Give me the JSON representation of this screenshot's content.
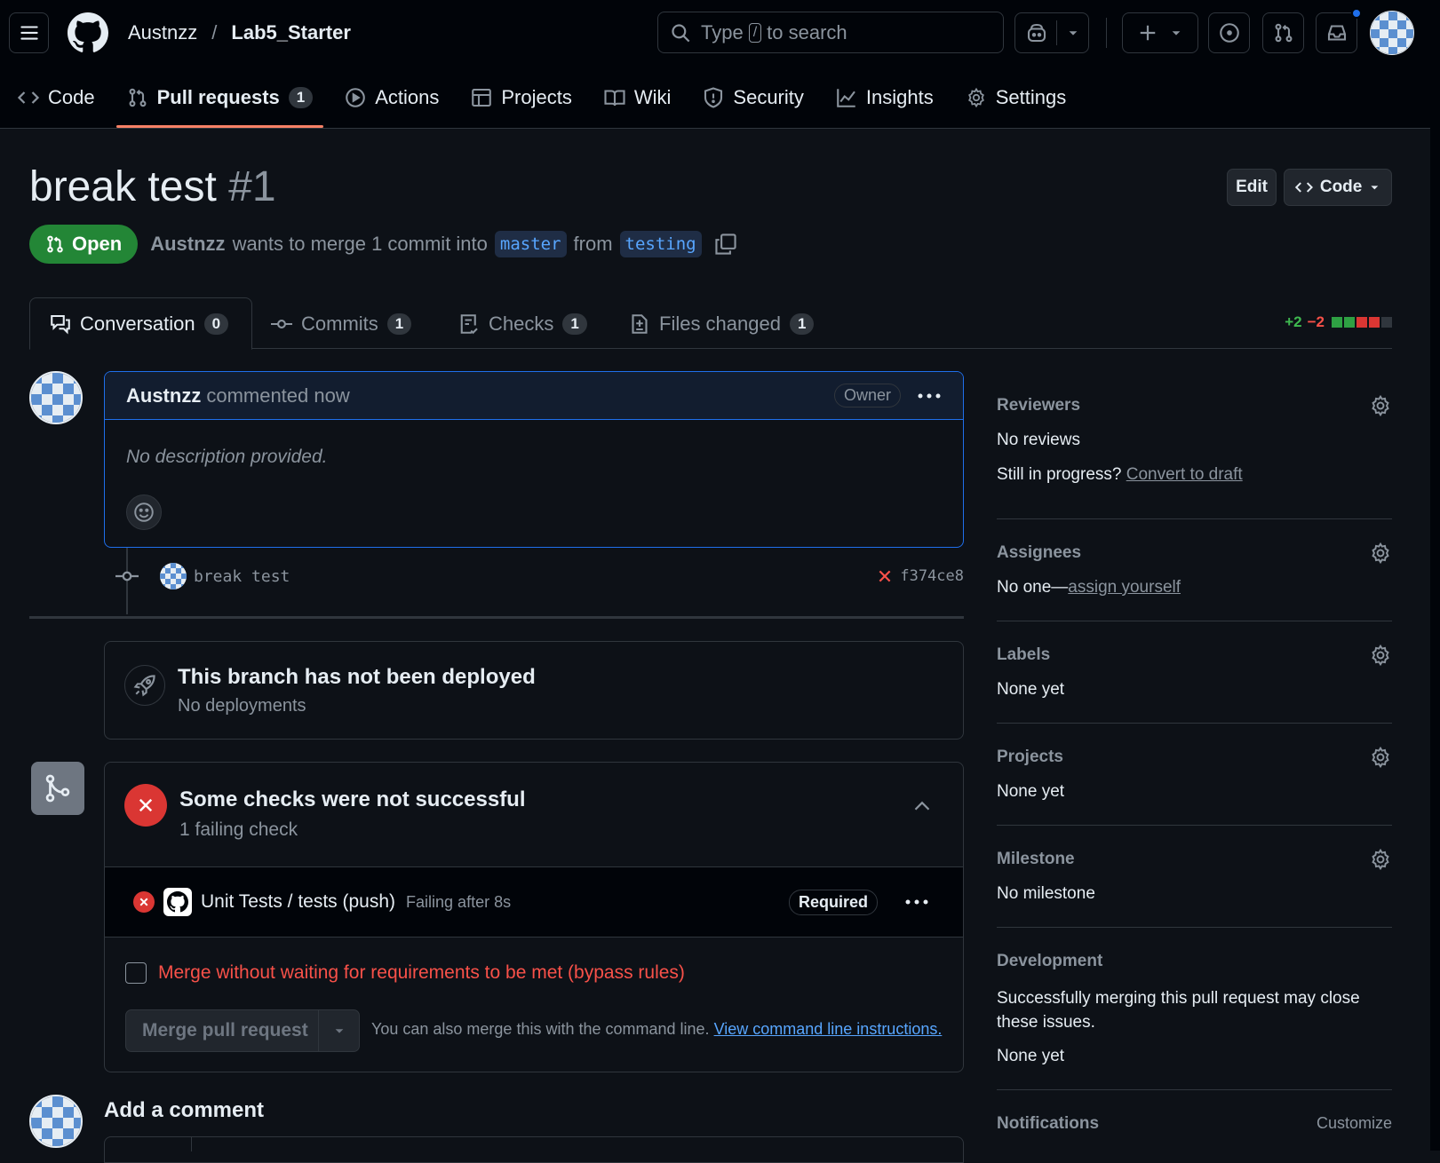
{
  "header": {
    "owner": "Austnzz",
    "separator": "/",
    "repo": "Lab5_Starter",
    "search": {
      "prefix": "Type",
      "key": "/",
      "suffix": "to search"
    }
  },
  "nav": [
    {
      "label": "Code",
      "icon": "code-icon"
    },
    {
      "label": "Pull requests",
      "icon": "pull-request-icon",
      "count": "1",
      "active": true
    },
    {
      "label": "Actions",
      "icon": "play-icon"
    },
    {
      "label": "Projects",
      "icon": "table-icon"
    },
    {
      "label": "Wiki",
      "icon": "book-icon"
    },
    {
      "label": "Security",
      "icon": "shield-icon"
    },
    {
      "label": "Insights",
      "icon": "graph-icon"
    },
    {
      "label": "Settings",
      "icon": "gear-icon"
    }
  ],
  "pr": {
    "title": "break test",
    "number": "#1",
    "edit_label": "Edit",
    "code_label": "Code",
    "state": "Open",
    "author": "Austnzz",
    "merge_text": "wants to merge 1 commit into",
    "base_branch": "master",
    "from_text": "from",
    "head_branch": "testing"
  },
  "tabs": [
    {
      "label": "Conversation",
      "count": "0"
    },
    {
      "label": "Commits",
      "count": "1"
    },
    {
      "label": "Checks",
      "count": "1"
    },
    {
      "label": "Files changed",
      "count": "1"
    }
  ],
  "diffstat": {
    "added": "+2",
    "removed": "−2",
    "blocks": [
      "#2ea043",
      "#2ea043",
      "#da3633",
      "#da3633",
      "#30363d"
    ]
  },
  "comment": {
    "author": "Austnzz",
    "meta": "commented now",
    "badge": "Owner",
    "body": "No description provided."
  },
  "commit": {
    "message": "break test",
    "sha": "f374ce8"
  },
  "deployment": {
    "title": "This branch has not been deployed",
    "subtitle": "No deployments"
  },
  "checks": {
    "title": "Some checks were not successful",
    "subtitle": "1 failing check",
    "item_name": "Unit Tests / tests (push)",
    "item_status": "Failing after 8s",
    "item_badge": "Required",
    "bypass_label": "Merge without waiting for requirements to be met (bypass rules)",
    "merge_button": "Merge pull request",
    "cli_text": "You can also merge this with the command line.",
    "cli_link": "View command line instructions."
  },
  "add_comment": {
    "title": "Add a comment"
  },
  "sidebar": {
    "reviewers": {
      "title": "Reviewers",
      "value": "No reviews",
      "progress_text": "Still in progress?",
      "progress_link": "Convert to draft"
    },
    "assignees": {
      "title": "Assignees",
      "value": "No one—",
      "link": "assign yourself"
    },
    "labels": {
      "title": "Labels",
      "value": "None yet"
    },
    "projects": {
      "title": "Projects",
      "value": "None yet"
    },
    "milestone": {
      "title": "Milestone",
      "value": "No milestone"
    },
    "development": {
      "title": "Development",
      "text": "Successfully merging this pull request may close these issues.",
      "value": "None yet"
    },
    "notifications": {
      "title": "Notifications",
      "link": "Customize"
    }
  },
  "colors": {
    "accent": "#f78166",
    "open": "#238636",
    "danger": "#f85149",
    "link": "#58a6ff",
    "bg": "#0d1117"
  }
}
